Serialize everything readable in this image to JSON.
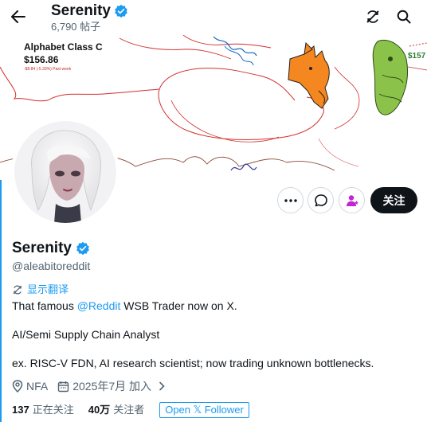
{
  "header": {
    "name": "Serenity",
    "posts_count": "6,790 帖子"
  },
  "banner": {
    "stock_name": "Alphabet Class C",
    "stock_price": "$156.86",
    "stock_change": "-$8.84 (-5.33%) Past week",
    "right_label": "$157"
  },
  "profile": {
    "name": "Serenity",
    "handle": "@aleabitoreddit",
    "translate_label": "显示翻译",
    "bio": {
      "line1_prefix": "That famous ",
      "line1_mention": "@Reddit",
      "line1_suffix": " WSB Trader now on X.",
      "line2": "AI/Semi Supply Chain Analyst",
      "line3": "ex. RISC-V FDN, AI research scientist; now trading unknown bottlenecks."
    },
    "location": "NFA",
    "joined": "2025年7月 加入",
    "following_count": "137",
    "following_label": "正在关注",
    "followers_count": "40万",
    "followers_label": "关注者",
    "open_follower_label": "Open 𝕏 Follower"
  },
  "actions": {
    "follow_label": "关注"
  },
  "colors": {
    "accent": "#1d9bf0",
    "verified": "#1d9bf0",
    "follow_bg": "#0f1419",
    "muted_text": "#536471",
    "subscribe_icon": "#c026d3"
  },
  "icons": [
    "back-arrow-icon",
    "verified-badge-icon",
    "refresh-icon",
    "search-icon",
    "more-icon",
    "message-icon",
    "subscribe-person-icon",
    "translate-icon",
    "location-icon",
    "calendar-icon",
    "chevron-right-icon"
  ]
}
